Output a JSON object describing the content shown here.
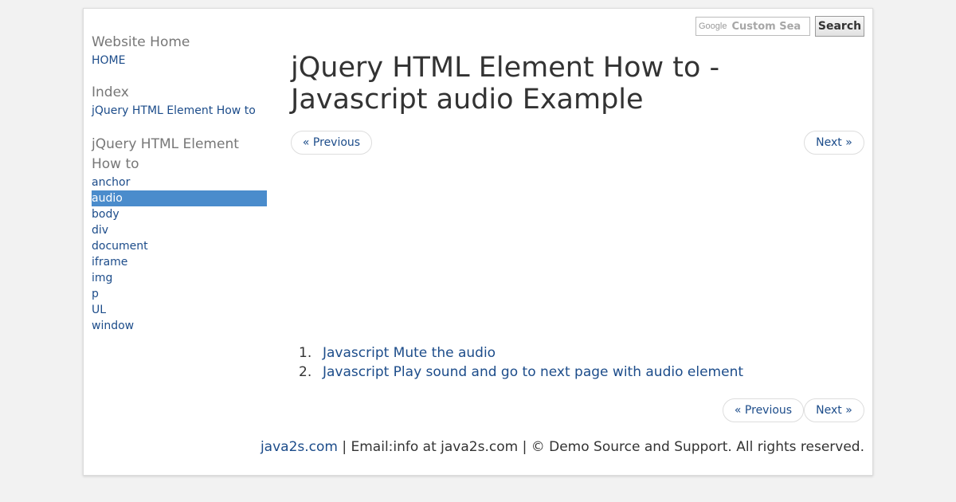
{
  "search": {
    "google_label": "Google",
    "placeholder": "Custom Sea",
    "button_label": "Search"
  },
  "sidebar": {
    "home_heading": "Website Home",
    "home_link": "HOME",
    "index_heading": "Index",
    "index_link": "jQuery HTML Element How to",
    "section_heading": "jQuery HTML Element How to",
    "items": [
      {
        "label": "anchor",
        "active": false
      },
      {
        "label": "audio",
        "active": true
      },
      {
        "label": "body",
        "active": false
      },
      {
        "label": "div",
        "active": false
      },
      {
        "label": "document",
        "active": false
      },
      {
        "label": "iframe",
        "active": false
      },
      {
        "label": "img",
        "active": false
      },
      {
        "label": "p",
        "active": false
      },
      {
        "label": "UL",
        "active": false
      },
      {
        "label": "window",
        "active": false
      }
    ]
  },
  "main": {
    "title_line1": "jQuery HTML Element How to -",
    "title_line2": "Javascript audio Example",
    "prev_label": "« Previous",
    "next_label": "Next »",
    "articles": [
      {
        "num": "1.",
        "label": "Javascript Mute the audio"
      },
      {
        "num": "2.",
        "label": "Javascript Play sound and go to next page with audio element"
      }
    ]
  },
  "footer": {
    "site": "java2s.com",
    "text": " | Email:info at java2s.com | © Demo Source and Support. All rights reserved."
  },
  "colors": {
    "link": "#1c4c8a",
    "active_bg": "#4a8ccc",
    "heading": "#777777"
  }
}
